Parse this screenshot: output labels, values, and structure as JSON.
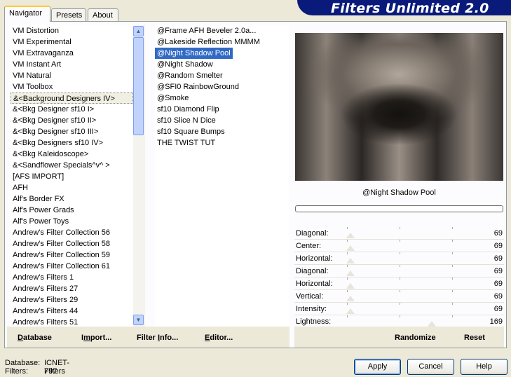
{
  "banner": {
    "title": "Filters Unlimited 2.0"
  },
  "tabs": [
    {
      "label": "Navigator",
      "active": true
    },
    {
      "label": "Presets",
      "active": false
    },
    {
      "label": "About",
      "active": false
    }
  ],
  "categories": [
    "VM Distortion",
    "VM Experimental",
    "VM Extravaganza",
    "VM Instant Art",
    "VM Natural",
    "VM Toolbox",
    "&<Background Designers IV>",
    "&<Bkg Designer sf10 I>",
    "&<Bkg Designer sf10 II>",
    "&<Bkg Designer sf10 III>",
    "&<Bkg Designers sf10 IV>",
    "&<Bkg Kaleidoscope>",
    "&<Sandflower Specials^v^ >",
    "[AFS IMPORT]",
    "AFH",
    "Alf's Border FX",
    "Alf's Power Grads",
    "Alf's Power Toys",
    "Andrew's Filter Collection 56",
    "Andrew's Filter Collection 58",
    "Andrew's Filter Collection 59",
    "Andrew's Filter Collection 61",
    "Andrew's Filters 1",
    "Andrew's Filters 27",
    "Andrew's Filters 29",
    "Andrew's Filters 44",
    "Andrew's Filters 51"
  ],
  "filters": [
    "@Frame AFH Beveler 2.0a...",
    "@Lakeside Reflection MMMM",
    "@Night Shadow Pool",
    "@Night Shadow",
    "@Random Smelter",
    "@SFI0 RainbowGround",
    "@Smoke",
    "sf10 Diamond Flip",
    "sf10 Slice N Dice",
    "sf10 Square Bumps",
    "THE TWIST TUT"
  ],
  "preview": {
    "filter_name": "@Night Shadow Pool"
  },
  "sliders": [
    {
      "label": "Diagonal:",
      "value": "69"
    },
    {
      "label": "Center:",
      "value": "69"
    },
    {
      "label": "Horizontal:",
      "value": "69"
    },
    {
      "label": "Diagonal:",
      "value": "69"
    },
    {
      "label": "Horizontal:",
      "value": "69"
    },
    {
      "label": "Vertical:",
      "value": "69"
    },
    {
      "label": "Intensity:",
      "value": "69"
    },
    {
      "label": "Lightness:",
      "value": "169"
    }
  ],
  "bottom_links": {
    "database": {
      "pre": "",
      "u": "D",
      "post": "atabase"
    },
    "import": {
      "pre": "I",
      "u": "m",
      "post": "port..."
    },
    "filter_info": {
      "pre": "Filter ",
      "u": "I",
      "post": "nfo..."
    },
    "editor": {
      "pre": "",
      "u": "E",
      "post": "ditor..."
    },
    "randomize": "Randomize",
    "reset": "Reset"
  },
  "status": {
    "database_label": "Database:",
    "database_value": "ICNET-Filters",
    "filters_label": "Filters:",
    "filters_value": "797"
  },
  "buttons": {
    "apply": "Apply",
    "cancel": "Cancel",
    "help": "Help"
  }
}
